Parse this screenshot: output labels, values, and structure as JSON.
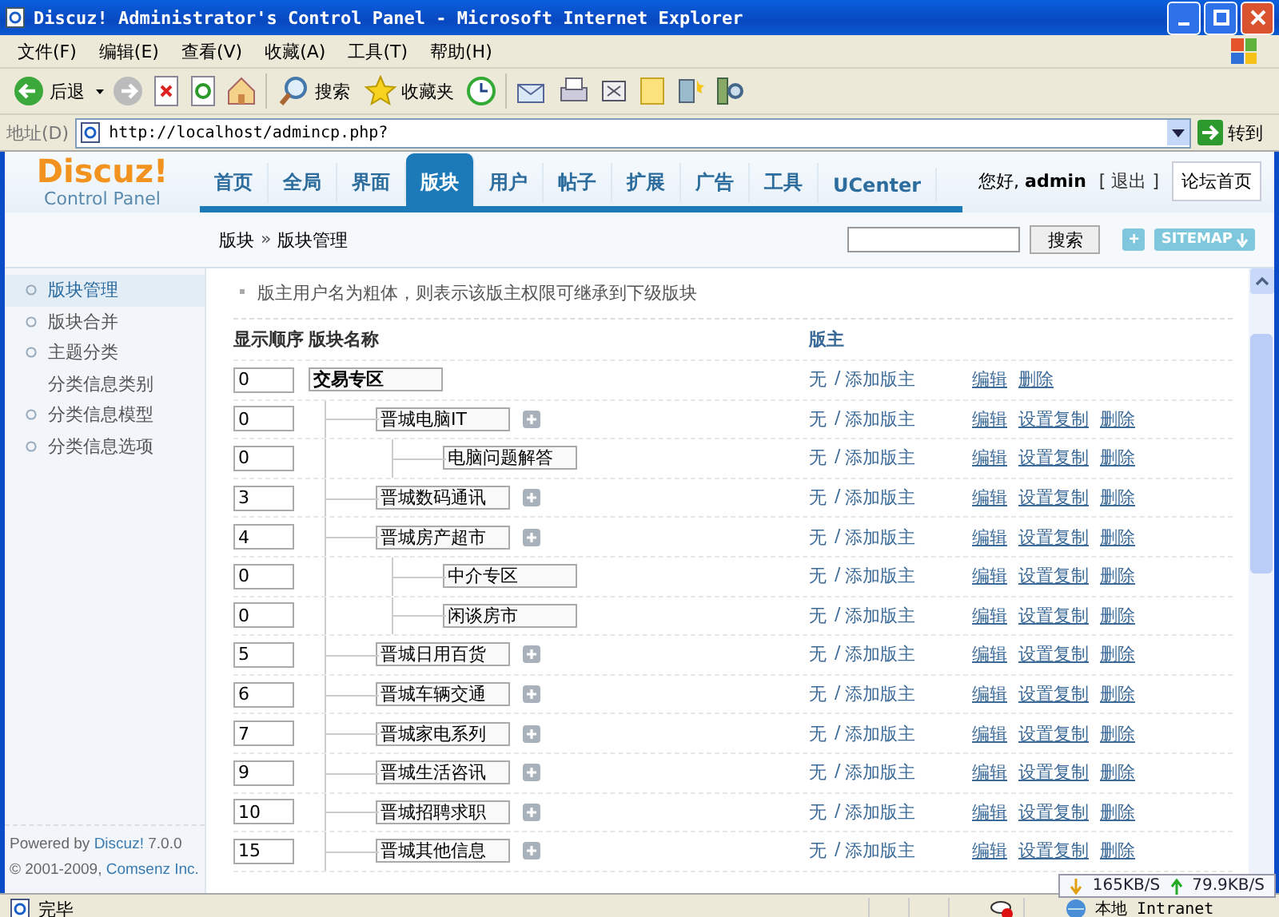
{
  "window": {
    "title": "Discuz! Administrator's Control Panel - Microsoft Internet Explorer"
  },
  "menu": [
    "文件(F)",
    "编辑(E)",
    "查看(V)",
    "收藏(A)",
    "工具(T)",
    "帮助(H)"
  ],
  "toolbar": {
    "back": "后退",
    "search": "搜索",
    "favorites": "收藏夹"
  },
  "address": {
    "label": "地址(D)",
    "value": "http://localhost/admincp.php?",
    "go": "转到"
  },
  "logo": {
    "title": "Discuz!",
    "subtitle": "Control Panel"
  },
  "nav": [
    {
      "label": "首页",
      "selected": false
    },
    {
      "label": "全局",
      "selected": false
    },
    {
      "label": "界面",
      "selected": false
    },
    {
      "label": "版块",
      "selected": true
    },
    {
      "label": "用户",
      "selected": false
    },
    {
      "label": "帖子",
      "selected": false
    },
    {
      "label": "扩展",
      "selected": false
    },
    {
      "label": "广告",
      "selected": false
    },
    {
      "label": "工具",
      "selected": false
    },
    {
      "label": "UCenter",
      "selected": false
    }
  ],
  "user": {
    "greeting": "您好,",
    "name": "admin",
    "logout": "[ 退出 ]",
    "home": "论坛首页"
  },
  "breadcrumb": {
    "items": [
      "版块",
      "版块管理"
    ],
    "separator": "»"
  },
  "search": {
    "button": "搜索"
  },
  "sitemap": {
    "plus": "+",
    "label": "SITEMAP"
  },
  "sidebar": [
    {
      "label": "版块管理",
      "kind": "bullet",
      "selected": true
    },
    {
      "label": "版块合并",
      "kind": "bullet",
      "selected": false
    },
    {
      "label": "主题分类",
      "kind": "bullet",
      "selected": false
    },
    {
      "label": "分类信息类别",
      "kind": "sub",
      "selected": false
    },
    {
      "label": "分类信息模型",
      "kind": "bullet",
      "selected": false
    },
    {
      "label": "分类信息选项",
      "kind": "bullet",
      "selected": false
    }
  ],
  "footer": [
    {
      "prefix": "Powered by ",
      "link": "Discuz!",
      "suffix": " 7.0.0"
    },
    {
      "prefix": "© 2001-2009, ",
      "link": "Comsenz Inc."
    }
  ],
  "note": "版主用户名为粗体，则表示该版主权限可继承到下级版块",
  "columns": [
    "显示顺序",
    "版块名称",
    "版主"
  ],
  "forums": [
    {
      "kind": "group",
      "order": "0",
      "name": "交易专区",
      "moderator": "无",
      "separator": "/",
      "add_moderator": "添加版主",
      "actions": [
        "编辑",
        "删除"
      ],
      "children": [
        {
          "kind": "forum",
          "order": "0",
          "name": "晋城电脑IT",
          "moderator": "无",
          "separator": "/",
          "add_moderator": "添加版主",
          "actions": [
            "编辑",
            "设置复制",
            "删除"
          ],
          "children": [
            {
              "kind": "sub",
              "order": "0",
              "name": "电脑问题解答",
              "moderator": "无",
              "separator": "/",
              "add_moderator": "添加版主",
              "actions": [
                "编辑",
                "设置复制",
                "删除"
              ]
            }
          ]
        },
        {
          "kind": "forum",
          "order": "3",
          "name": "晋城数码通讯",
          "moderator": "无",
          "separator": "/",
          "add_moderator": "添加版主",
          "actions": [
            "编辑",
            "设置复制",
            "删除"
          ]
        },
        {
          "kind": "forum",
          "order": "4",
          "name": "晋城房产超市",
          "moderator": "无",
          "separator": "/",
          "add_moderator": "添加版主",
          "actions": [
            "编辑",
            "设置复制",
            "删除"
          ],
          "children": [
            {
              "kind": "sub",
              "order": "0",
              "name": "中介专区",
              "moderator": "无",
              "separator": "/",
              "add_moderator": "添加版主",
              "actions": [
                "编辑",
                "设置复制",
                "删除"
              ]
            },
            {
              "kind": "sub",
              "order": "0",
              "name": "闲谈房市",
              "moderator": "无",
              "separator": "/",
              "add_moderator": "添加版主",
              "actions": [
                "编辑",
                "设置复制",
                "删除"
              ]
            }
          ]
        },
        {
          "kind": "forum",
          "order": "5",
          "name": "晋城日用百货",
          "moderator": "无",
          "separator": "/",
          "add_moderator": "添加版主",
          "actions": [
            "编辑",
            "设置复制",
            "删除"
          ]
        },
        {
          "kind": "forum",
          "order": "6",
          "name": "晋城车辆交通",
          "moderator": "无",
          "separator": "/",
          "add_moderator": "添加版主",
          "actions": [
            "编辑",
            "设置复制",
            "删除"
          ]
        },
        {
          "kind": "forum",
          "order": "7",
          "name": "晋城家电系列",
          "moderator": "无",
          "separator": "/",
          "add_moderator": "添加版主",
          "actions": [
            "编辑",
            "设置复制",
            "删除"
          ]
        },
        {
          "kind": "forum",
          "order": "9",
          "name": "晋城生活咨讯",
          "moderator": "无",
          "separator": "/",
          "add_moderator": "添加版主",
          "actions": [
            "编辑",
            "设置复制",
            "删除"
          ]
        },
        {
          "kind": "forum",
          "order": "10",
          "name": "晋城招聘求职",
          "moderator": "无",
          "separator": "/",
          "add_moderator": "添加版主",
          "actions": [
            "编辑",
            "设置复制",
            "删除"
          ]
        },
        {
          "kind": "forum",
          "order": "15",
          "name": "晋城其他信息",
          "moderator": "无",
          "separator": "/",
          "add_moderator": "添加版主",
          "actions": [
            "编辑",
            "设置复制",
            "删除"
          ]
        }
      ]
    }
  ],
  "status": {
    "text": "完毕",
    "zone": "本地 Intranet"
  },
  "speed": {
    "down": "165KB/S",
    "up": "79.9KB/S"
  }
}
